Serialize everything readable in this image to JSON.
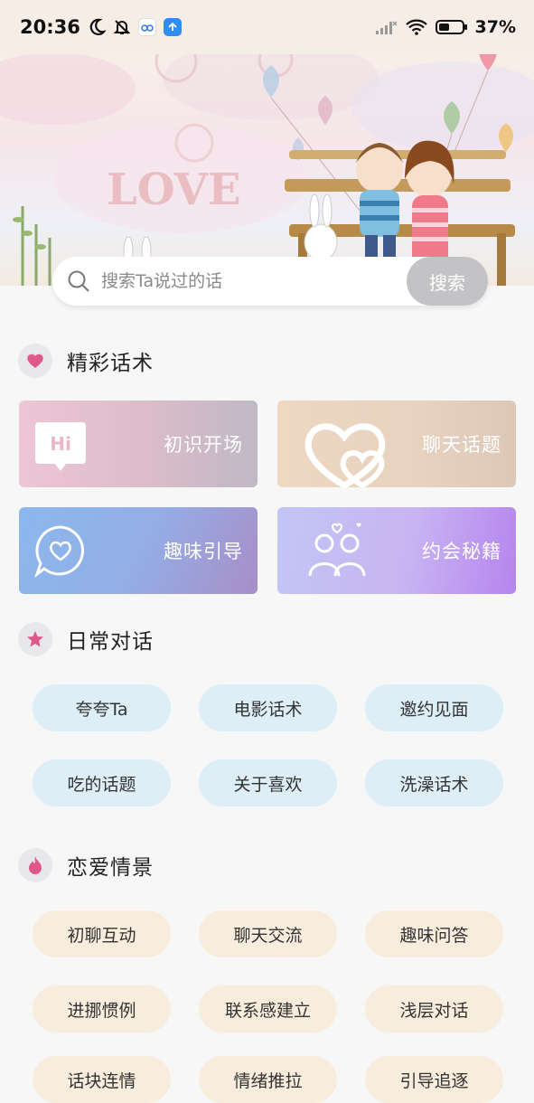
{
  "status_bar": {
    "time": "20:36",
    "battery": "37%"
  },
  "search": {
    "placeholder": "搜索Ta说过的话",
    "button_label": "搜索"
  },
  "banner": {
    "text": "LOVE"
  },
  "sections": {
    "featured": {
      "title": "精彩话术",
      "cards": [
        {
          "label": "初识开场",
          "icon_text": "Hi"
        },
        {
          "label": "聊天话题"
        },
        {
          "label": "趣味引导"
        },
        {
          "label": "约会秘籍"
        }
      ]
    },
    "daily": {
      "title": "日常对话",
      "tags": [
        "夸夸Ta",
        "电影话术",
        "邀约见面",
        "吃的话题",
        "关于喜欢",
        "洗澡话术"
      ]
    },
    "love": {
      "title": "恋爱情景",
      "tags": [
        "初聊互动",
        "聊天交流",
        "趣味问答",
        "进挪惯例",
        "联系感建立",
        "浅层对话",
        "话块连情",
        "情绪推拉",
        "引导追逐"
      ]
    }
  },
  "colors": {
    "pill_blue": "#ddeef6",
    "pill_beige": "#f8eddd",
    "accent_pink": "#e0588a"
  }
}
